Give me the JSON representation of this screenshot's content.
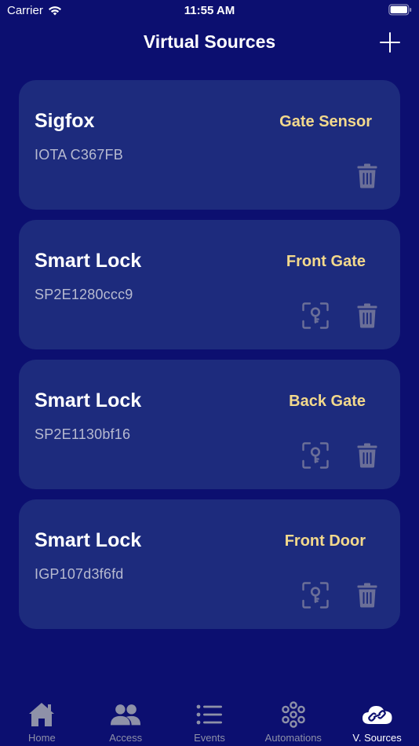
{
  "status_bar": {
    "carrier": "Carrier",
    "time": "11:55 AM"
  },
  "nav": {
    "title": "Virtual Sources"
  },
  "sources": [
    {
      "name": "Sigfox",
      "id": "IOTA C367FB",
      "label": "Gate Sensor"
    },
    {
      "name": "Smart Lock",
      "id": "SP2E1280ccc9",
      "label": "Front Gate"
    },
    {
      "name": "Smart Lock",
      "id": "SP2E1130bf16",
      "label": "Back Gate"
    },
    {
      "name": "Smart Lock",
      "id": "IGP107d3f6fd",
      "label": "Front Door"
    }
  ],
  "tabs": [
    {
      "label": "Home",
      "icon": "home-icon"
    },
    {
      "label": "Access",
      "icon": "people-icon"
    },
    {
      "label": "Events",
      "icon": "list-icon"
    },
    {
      "label": "Automations",
      "icon": "automations-icon"
    },
    {
      "label": "V. Sources",
      "icon": "cloud-link-icon",
      "active": true
    }
  ],
  "colors": {
    "background": "#0c0f70",
    "card": "#1d2b7d",
    "label": "#f3d98c",
    "muted_icon": "#6b6f98",
    "tab_inactive": "#8e91a8"
  }
}
